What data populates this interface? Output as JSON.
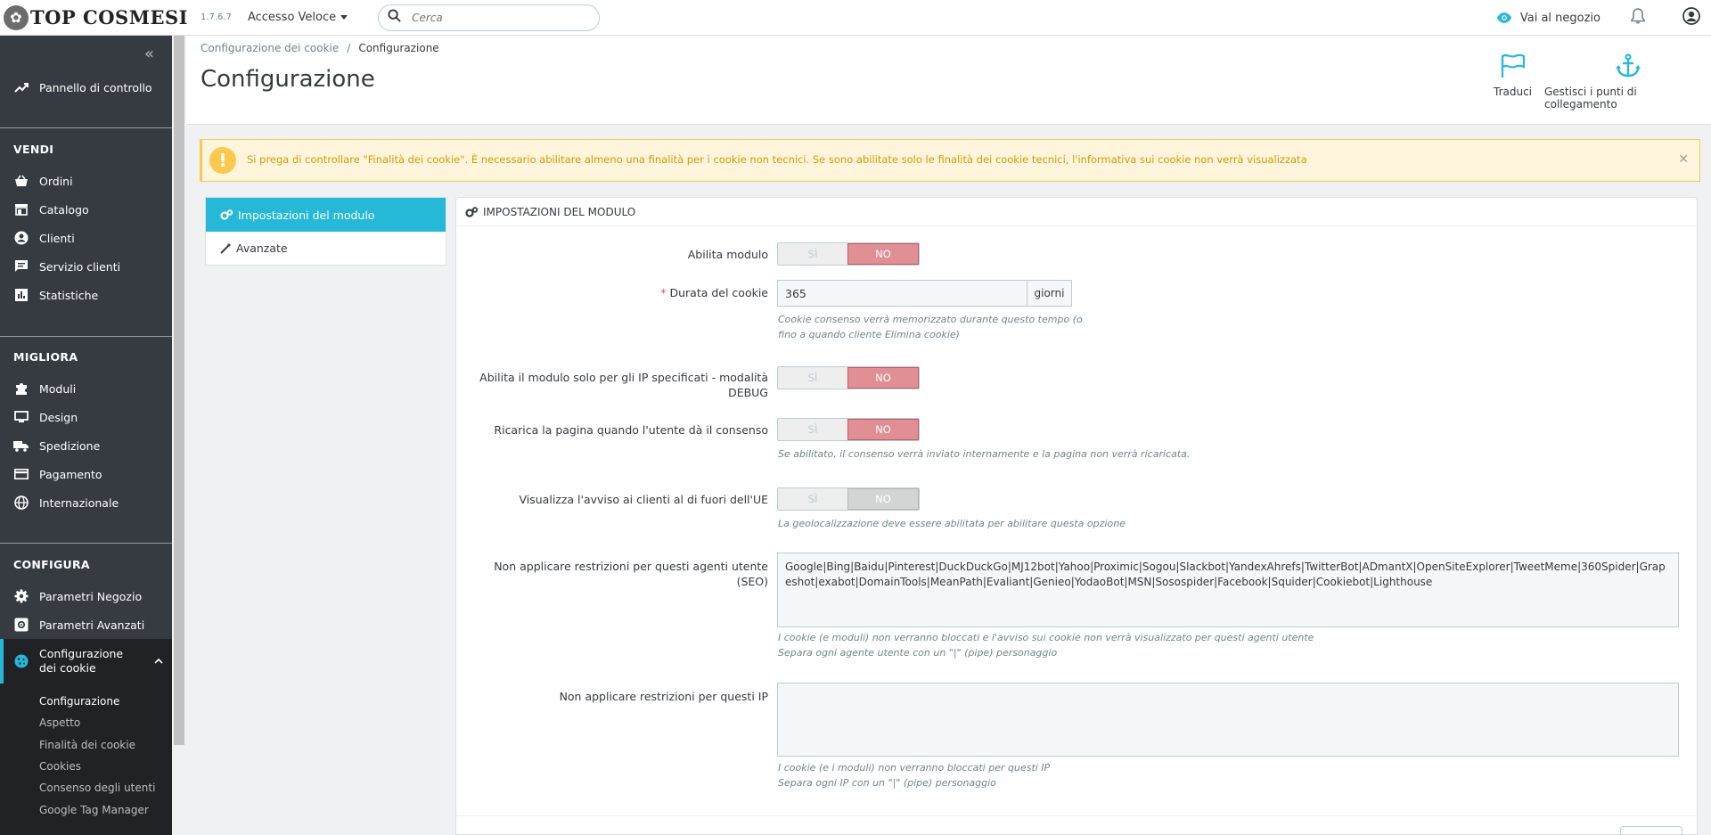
{
  "header": {
    "logo_text": "TOP COSMESI",
    "version": "1.7.6.7",
    "quick_access": "Accesso Veloce",
    "search_placeholder": "Cerca",
    "visit_store": "Vai al negozio"
  },
  "sidebar": {
    "dashboard": "Pannello di controllo",
    "sections": [
      {
        "title": "VENDI",
        "items": [
          "Ordini",
          "Catalogo",
          "Clienti",
          "Servizio clienti",
          "Statistiche"
        ]
      },
      {
        "title": "MIGLIORA",
        "items": [
          "Moduli",
          "Design",
          "Spedizione",
          "Pagamento",
          "Internazionale"
        ]
      },
      {
        "title": "CONFIGURA",
        "items": [
          "Parametri Negozio",
          "Parametri Avanzati"
        ]
      }
    ],
    "active_item": "Configurazione dei cookie",
    "sub_items": [
      "Configurazione",
      "Aspetto",
      "Finalità dei cookie",
      "Cookies",
      "Consenso degli utenti",
      "Google Tag Manager"
    ]
  },
  "page": {
    "breadcrumb": [
      "Configurazione dei cookie",
      "Configurazione"
    ],
    "title": "Configurazione",
    "toolbar": {
      "translate": "Traduci",
      "hooks": "Gestisci i punti di collegamento"
    }
  },
  "alert": {
    "text": "Si prega di controllare \"Finalità dei cookie\". È necessario abilitare almeno una finalità per i cookie non tecnici. Se sono abilitate solo le finalità dei cookie tecnici, l'informativa sui cookie non verrà visualizzata"
  },
  "tabs": [
    "Impostazioni del modulo",
    "Avanzate"
  ],
  "panel": {
    "title": "Impostazioni del modulo",
    "yes_label": "SÌ",
    "no_label": "NO",
    "fields": {
      "enable_module": {
        "label": "Abilita modulo",
        "value": "NO"
      },
      "cookie_duration": {
        "label": "Durata del cookie",
        "value": "365",
        "addon": "giorni",
        "help_line1": "Cookie consenso verrà memorizzato durante questo tempo (o",
        "help_line2": "fino a quando cliente Elimina cookie)"
      },
      "debug_ip": {
        "label_line1": "Abilita il modulo solo per gli IP specificati - modalità",
        "label_line2": "DEBUG",
        "value": "NO"
      },
      "reload_page": {
        "label": "Ricarica la pagina quando l'utente dà il consenso",
        "value": "NO",
        "help": "Se abilitato, il consenso verrà inviato internamente e la pagina non verrà ricaricata."
      },
      "non_eu_notice": {
        "label": "Visualizza l'avviso ai clienti al di fuori dell'UE",
        "value": "NO",
        "help": "La geolocalizzazione deve essere abilitata per abilitare questa opzione"
      },
      "user_agents": {
        "label_line1": "Non applicare restrizioni per questi agenti utente",
        "label_line2": "(SEO)",
        "value": "Google|Bing|Baidu|Pinterest|DuckDuckGo|MJ12bot|Yahoo|Proximic|Sogou|Slackbot|YandexAhrefs|TwitterBot|ADmantX|OpenSiteExplorer|TweetMeme|360Spider|Grapeshot|exabot|DomainTools|MeanPath|Evaliant|Genieo|YodaoBot|MSN|Sosospider|Facebook|Squider|Cookiebot|Lighthouse",
        "help_line1": "I cookie (e moduli) non verranno bloccati e l'avviso sui cookie non verrà visualizzato per questi agenti utente",
        "help_line2": "Separa ogni agente utente con un \"|\" (pipe) personaggio"
      },
      "ips": {
        "label": "Non applicare restrizioni per questi IP",
        "value": "",
        "help_line1": "I cookie (e i moduli) non verranno bloccati per questi IP",
        "help_line2": "Separa ogni IP con un \"|\" (pipe) personaggio"
      }
    }
  },
  "colors": {
    "accent": "#25b9d7",
    "sidebar_bg": "#363a41",
    "warning": "#fcc94f",
    "switch_no": "#e08f95"
  }
}
